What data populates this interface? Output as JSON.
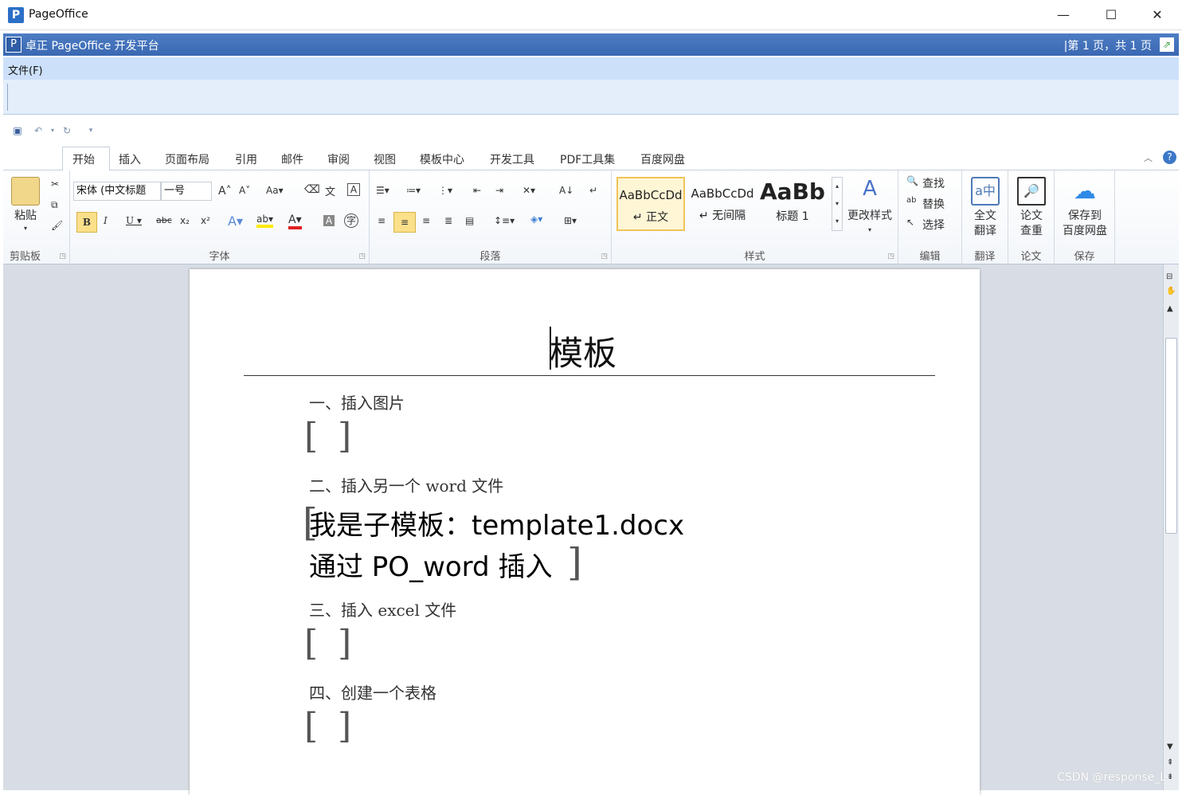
{
  "window": {
    "title": "PageOffice",
    "controls": [
      "—",
      "☐",
      "✕"
    ]
  },
  "header": {
    "title": "卓正 PageOffice 开发平台",
    "page_info": "|第 1 页，共 1 页"
  },
  "menu": {
    "file": "文件(F)"
  },
  "tabs": [
    "开始",
    "插入",
    "页面布局",
    "引用",
    "邮件",
    "审阅",
    "视图",
    "模板中心",
    "开发工具",
    "PDF工具集",
    "百度网盘"
  ],
  "ribbon": {
    "clipboard": {
      "paste": "粘贴",
      "label": "剪贴板"
    },
    "font": {
      "font_name": "宋体 (中文标题",
      "font_size": "一号",
      "label": "字体"
    },
    "paragraph": {
      "label": "段落"
    },
    "styles": {
      "items": [
        {
          "preview": "AaBbCcDd",
          "name": "↵ 正文"
        },
        {
          "preview": "AaBbCcDd",
          "name": "↵ 无间隔"
        },
        {
          "preview": "AaBb",
          "name": "标题 1"
        }
      ],
      "change": "更改样式",
      "label": "样式"
    },
    "editing": {
      "find": "查找",
      "replace": "替换",
      "select": "选择",
      "label": "编辑"
    },
    "translate": {
      "button": [
        "全文",
        "翻译"
      ],
      "label": "翻译"
    },
    "paper": {
      "button": [
        "论文",
        "查重"
      ],
      "label": "论文"
    },
    "save": {
      "button": [
        "保存到",
        "百度网盘"
      ],
      "label": "保存"
    }
  },
  "document": {
    "title": "模板",
    "sections": [
      {
        "heading": "一、插入图片"
      },
      {
        "heading": "二、插入另一个 word 文件"
      },
      {
        "heading": "三、插入 excel 文件"
      },
      {
        "heading": "四、创建一个表格"
      }
    ],
    "subdoc": [
      "我是子模板：template1.docx",
      "通过 PO_word 插入"
    ]
  },
  "watermark": "CSDN @response_L"
}
